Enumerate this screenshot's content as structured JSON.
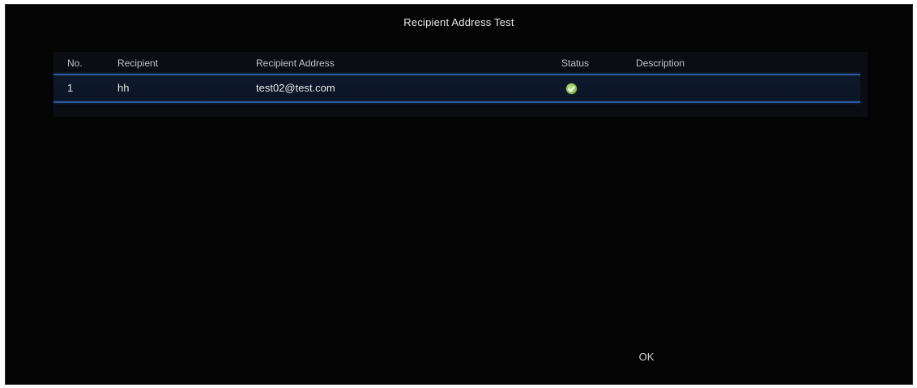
{
  "dialog": {
    "title": "Recipient Address Test",
    "ok_label": "OK"
  },
  "table": {
    "columns": [
      "No.",
      "Recipient",
      "Recipient Address",
      "Status",
      "Description"
    ],
    "rows": [
      {
        "no": "1",
        "recipient": "hh",
        "address": "test02@test.com",
        "status_icon": "success-check-icon",
        "description": ""
      }
    ]
  },
  "colors": {
    "background": "#040404",
    "accent_line": "#2c5a9e",
    "success": "#7bbf45"
  }
}
